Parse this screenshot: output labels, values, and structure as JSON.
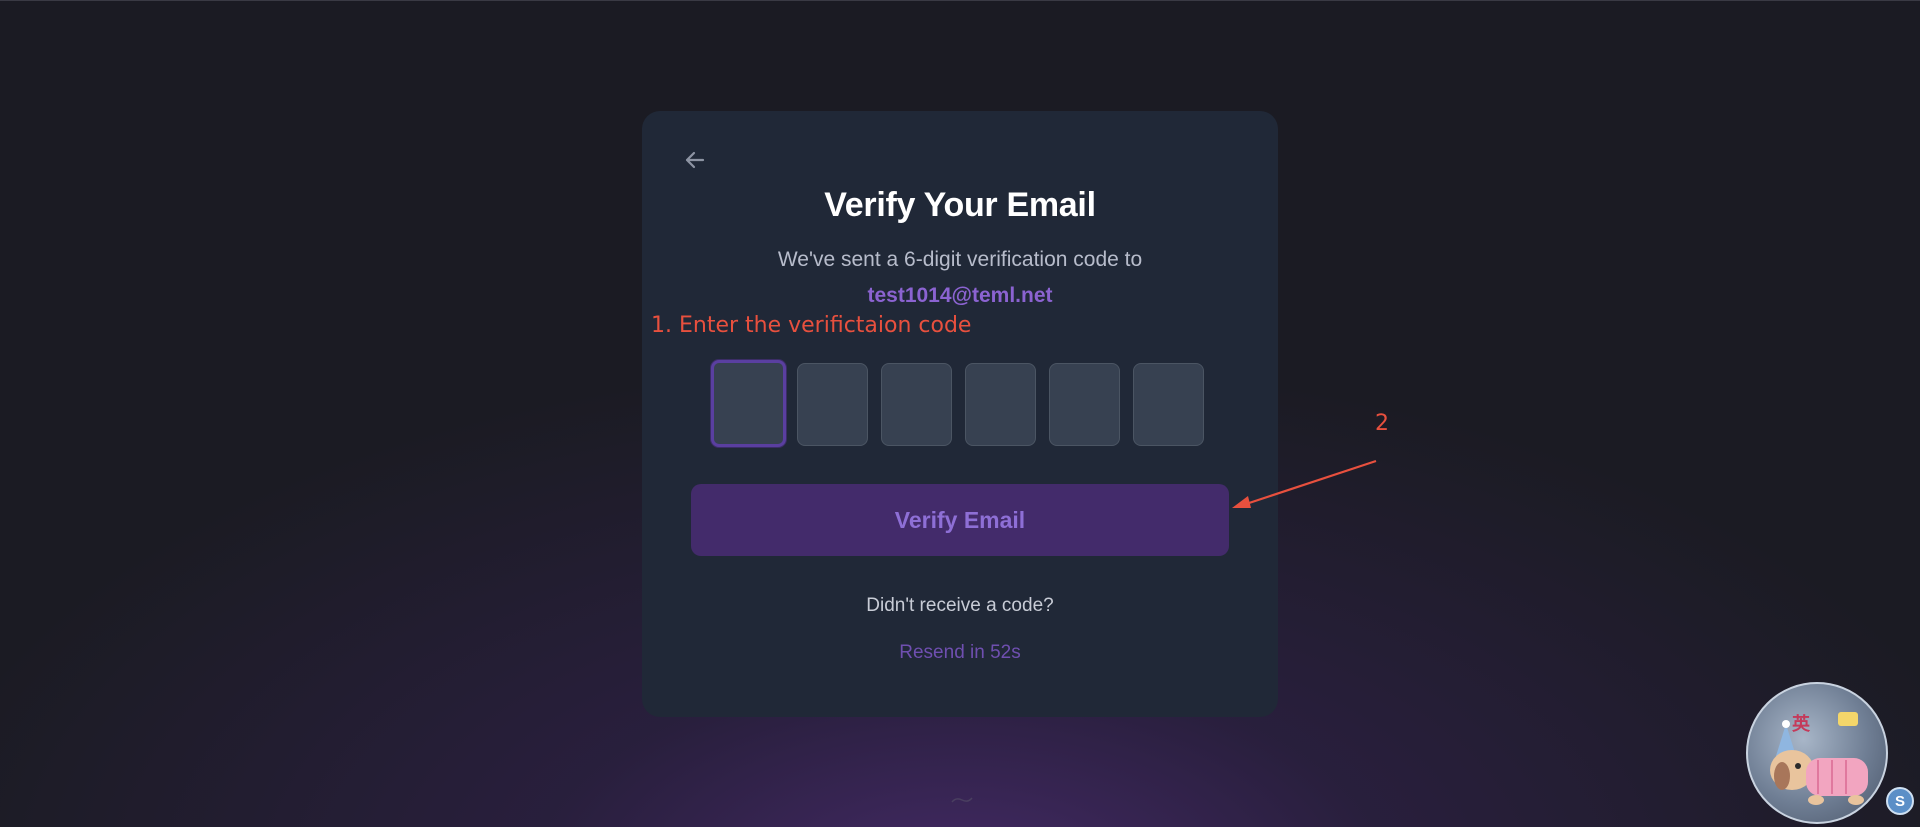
{
  "card": {
    "title": "Verify Your Email",
    "subtitle": "We've sent a 6-digit verification code to",
    "email": "test1014@teml.net",
    "code_digits": [
      "",
      "",
      "",
      "",
      "",
      ""
    ],
    "verify_button_label": "Verify Email",
    "didnt_receive_text": "Didn't receive a code?",
    "resend_text": "Resend in 52s"
  },
  "annotations": {
    "step1": "1. Enter the verifictaion code",
    "step2": "2"
  },
  "widget": {
    "label": "英",
    "badge": "S"
  },
  "colors": {
    "background": "#1b1b23",
    "card": "#202837",
    "accent_purple": "#8b63d1",
    "button_bg": "#432b6b",
    "annotation_red": "#e8503e"
  },
  "icons": {
    "back": "arrow-left-icon",
    "widget_badge": "s-badge-icon",
    "mascot": "dog-mascot-icon"
  }
}
